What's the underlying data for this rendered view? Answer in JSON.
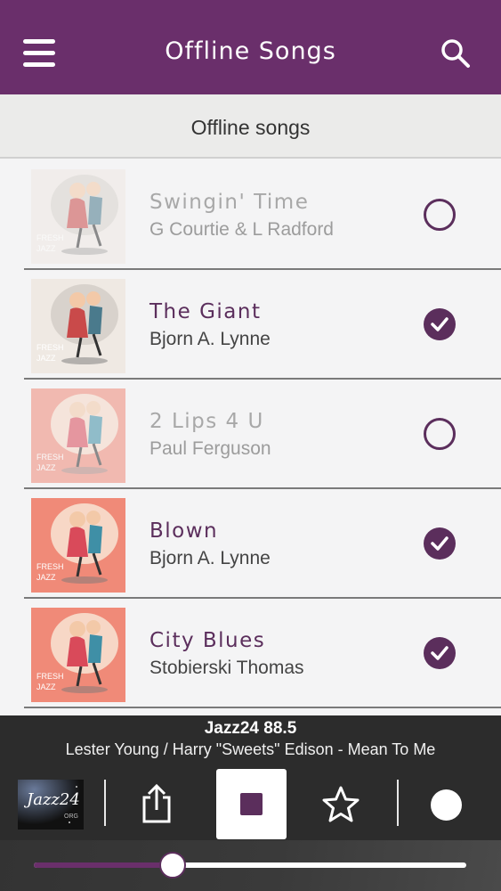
{
  "header": {
    "title": "Offline Songs",
    "menu_icon": "hamburger-menu-icon",
    "search_icon": "search-icon"
  },
  "subheader": {
    "title": "Offline songs"
  },
  "songs": [
    {
      "title": "Swingin' Time",
      "artist": "G Courtie & L Radford",
      "selected": false,
      "cover_text": "FRESH JAZZ"
    },
    {
      "title": "The Giant",
      "artist": "Bjorn A. Lynne",
      "selected": true,
      "cover_text": "FRESH JAZZ"
    },
    {
      "title": "2 Lips 4 U",
      "artist": "Paul Ferguson",
      "selected": false,
      "cover_text": "FRESH JAZZ"
    },
    {
      "title": "Blown",
      "artist": "Bjorn A. Lynne",
      "selected": true,
      "cover_text": "FRESH JAZZ"
    },
    {
      "title": "City Blues",
      "artist": "Stobierski Thomas",
      "selected": true,
      "cover_text": "FRESH JAZZ"
    }
  ],
  "player": {
    "station": "Jazz24 88.5",
    "track": "Lester Young / Harry \"Sweets\" Edison - Mean To Me",
    "logo_text": "Jazz24",
    "logo_org": "ORG",
    "progress": 0.32
  },
  "colors": {
    "accent": "#6a2f6b",
    "check": "#5b2e5c"
  }
}
